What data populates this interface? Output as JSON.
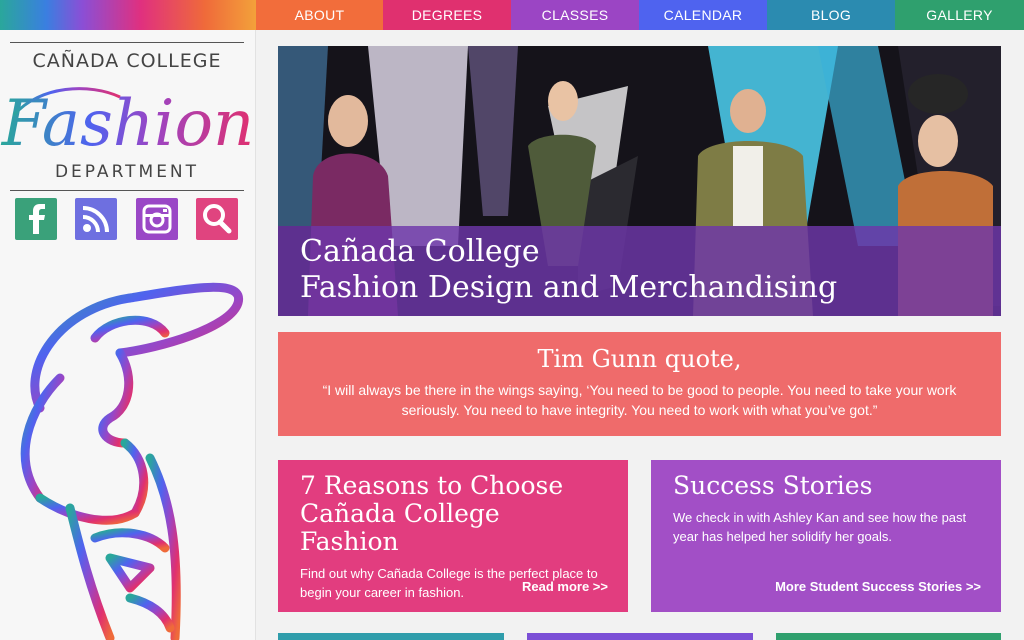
{
  "nav": {
    "items": [
      {
        "label": "ABOUT",
        "color": "#f26d3b"
      },
      {
        "label": "DEGREES",
        "color": "#e0306f"
      },
      {
        "label": "CLASSES",
        "color": "#9b45c4"
      },
      {
        "label": "CALENDAR",
        "color": "#4f63ef"
      },
      {
        "label": "BLOG",
        "color": "#2b8bb0"
      },
      {
        "label": "GALLERY",
        "color": "#2fa06e"
      }
    ]
  },
  "logo": {
    "top": "CAÑADA COLLEGE",
    "script": "Fashion",
    "bottom": "DEPARTMENT"
  },
  "social": [
    {
      "icon": "facebook-icon",
      "color": "#3aa17a"
    },
    {
      "icon": "rss-icon",
      "color": "#6e6fe0"
    },
    {
      "icon": "instagram-icon",
      "color": "#9a48c6"
    },
    {
      "icon": "search-icon",
      "color": "#e0447f"
    }
  ],
  "hero": {
    "line1": "Cañada College",
    "line2": "Fashion Design and Merchandising"
  },
  "quote": {
    "title": "Tim Gunn quote,",
    "text": "“I will always be there in the wings saying, ‘You need to be good to people. You need to take your work seriously. You need to have integrity. You need to work with what you’ve got.”",
    "color": "#ef6b6b"
  },
  "cards": [
    {
      "title": "7 Reasons to Choose Cañada College Fashion",
      "text": "Find out why Cañada College is the perfect place to begin your career in fashion.",
      "link": "Read more >>",
      "color": "#e23d7f"
    },
    {
      "title": "Success Stories",
      "text": "We check in with Ashley Kan and see how the past year has helped her solidify her goals.",
      "link": "More Student Success Stories >>",
      "color": "#a24fc6"
    }
  ],
  "bottom_strips": [
    "#2f9dab",
    "#7b4fd6",
    "#2fa06e"
  ]
}
